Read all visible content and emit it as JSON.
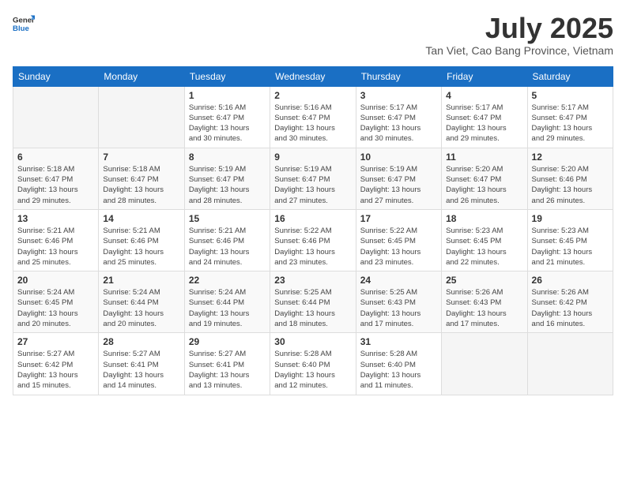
{
  "header": {
    "logo_line1": "General",
    "logo_line2": "Blue",
    "month": "July 2025",
    "location": "Tan Viet, Cao Bang Province, Vietnam"
  },
  "weekdays": [
    "Sunday",
    "Monday",
    "Tuesday",
    "Wednesday",
    "Thursday",
    "Friday",
    "Saturday"
  ],
  "weeks": [
    [
      {
        "day": "",
        "info": ""
      },
      {
        "day": "",
        "info": ""
      },
      {
        "day": "1",
        "info": "Sunrise: 5:16 AM\nSunset: 6:47 PM\nDaylight: 13 hours\nand 30 minutes."
      },
      {
        "day": "2",
        "info": "Sunrise: 5:16 AM\nSunset: 6:47 PM\nDaylight: 13 hours\nand 30 minutes."
      },
      {
        "day": "3",
        "info": "Sunrise: 5:17 AM\nSunset: 6:47 PM\nDaylight: 13 hours\nand 30 minutes."
      },
      {
        "day": "4",
        "info": "Sunrise: 5:17 AM\nSunset: 6:47 PM\nDaylight: 13 hours\nand 29 minutes."
      },
      {
        "day": "5",
        "info": "Sunrise: 5:17 AM\nSunset: 6:47 PM\nDaylight: 13 hours\nand 29 minutes."
      }
    ],
    [
      {
        "day": "6",
        "info": "Sunrise: 5:18 AM\nSunset: 6:47 PM\nDaylight: 13 hours\nand 29 minutes."
      },
      {
        "day": "7",
        "info": "Sunrise: 5:18 AM\nSunset: 6:47 PM\nDaylight: 13 hours\nand 28 minutes."
      },
      {
        "day": "8",
        "info": "Sunrise: 5:19 AM\nSunset: 6:47 PM\nDaylight: 13 hours\nand 28 minutes."
      },
      {
        "day": "9",
        "info": "Sunrise: 5:19 AM\nSunset: 6:47 PM\nDaylight: 13 hours\nand 27 minutes."
      },
      {
        "day": "10",
        "info": "Sunrise: 5:19 AM\nSunset: 6:47 PM\nDaylight: 13 hours\nand 27 minutes."
      },
      {
        "day": "11",
        "info": "Sunrise: 5:20 AM\nSunset: 6:47 PM\nDaylight: 13 hours\nand 26 minutes."
      },
      {
        "day": "12",
        "info": "Sunrise: 5:20 AM\nSunset: 6:46 PM\nDaylight: 13 hours\nand 26 minutes."
      }
    ],
    [
      {
        "day": "13",
        "info": "Sunrise: 5:21 AM\nSunset: 6:46 PM\nDaylight: 13 hours\nand 25 minutes."
      },
      {
        "day": "14",
        "info": "Sunrise: 5:21 AM\nSunset: 6:46 PM\nDaylight: 13 hours\nand 25 minutes."
      },
      {
        "day": "15",
        "info": "Sunrise: 5:21 AM\nSunset: 6:46 PM\nDaylight: 13 hours\nand 24 minutes."
      },
      {
        "day": "16",
        "info": "Sunrise: 5:22 AM\nSunset: 6:46 PM\nDaylight: 13 hours\nand 23 minutes."
      },
      {
        "day": "17",
        "info": "Sunrise: 5:22 AM\nSunset: 6:45 PM\nDaylight: 13 hours\nand 23 minutes."
      },
      {
        "day": "18",
        "info": "Sunrise: 5:23 AM\nSunset: 6:45 PM\nDaylight: 13 hours\nand 22 minutes."
      },
      {
        "day": "19",
        "info": "Sunrise: 5:23 AM\nSunset: 6:45 PM\nDaylight: 13 hours\nand 21 minutes."
      }
    ],
    [
      {
        "day": "20",
        "info": "Sunrise: 5:24 AM\nSunset: 6:45 PM\nDaylight: 13 hours\nand 20 minutes."
      },
      {
        "day": "21",
        "info": "Sunrise: 5:24 AM\nSunset: 6:44 PM\nDaylight: 13 hours\nand 20 minutes."
      },
      {
        "day": "22",
        "info": "Sunrise: 5:24 AM\nSunset: 6:44 PM\nDaylight: 13 hours\nand 19 minutes."
      },
      {
        "day": "23",
        "info": "Sunrise: 5:25 AM\nSunset: 6:44 PM\nDaylight: 13 hours\nand 18 minutes."
      },
      {
        "day": "24",
        "info": "Sunrise: 5:25 AM\nSunset: 6:43 PM\nDaylight: 13 hours\nand 17 minutes."
      },
      {
        "day": "25",
        "info": "Sunrise: 5:26 AM\nSunset: 6:43 PM\nDaylight: 13 hours\nand 17 minutes."
      },
      {
        "day": "26",
        "info": "Sunrise: 5:26 AM\nSunset: 6:42 PM\nDaylight: 13 hours\nand 16 minutes."
      }
    ],
    [
      {
        "day": "27",
        "info": "Sunrise: 5:27 AM\nSunset: 6:42 PM\nDaylight: 13 hours\nand 15 minutes."
      },
      {
        "day": "28",
        "info": "Sunrise: 5:27 AM\nSunset: 6:41 PM\nDaylight: 13 hours\nand 14 minutes."
      },
      {
        "day": "29",
        "info": "Sunrise: 5:27 AM\nSunset: 6:41 PM\nDaylight: 13 hours\nand 13 minutes."
      },
      {
        "day": "30",
        "info": "Sunrise: 5:28 AM\nSunset: 6:40 PM\nDaylight: 13 hours\nand 12 minutes."
      },
      {
        "day": "31",
        "info": "Sunrise: 5:28 AM\nSunset: 6:40 PM\nDaylight: 13 hours\nand 11 minutes."
      },
      {
        "day": "",
        "info": ""
      },
      {
        "day": "",
        "info": ""
      }
    ]
  ]
}
